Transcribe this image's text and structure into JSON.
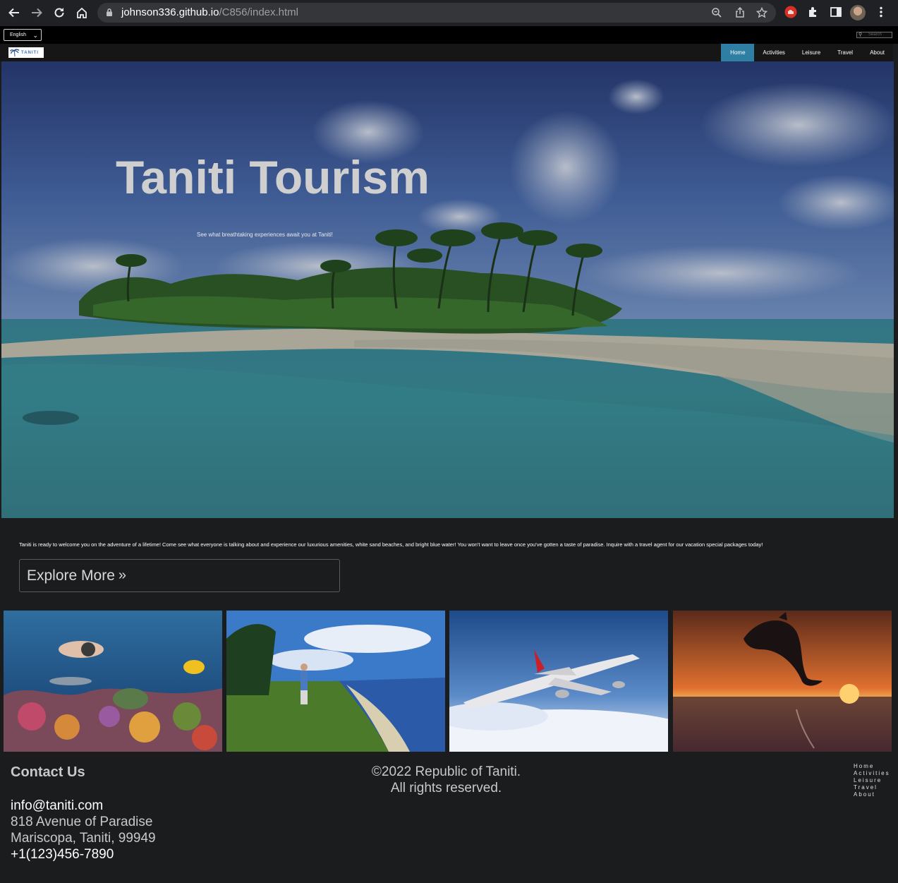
{
  "browser": {
    "url_host": "johnson336.github.io",
    "url_path": "/C856/index.html"
  },
  "utility": {
    "language": "English",
    "search_placeholder": "Search"
  },
  "nav": {
    "logo_text": "TANITI",
    "links": [
      "Home",
      "Activities",
      "Leisure",
      "Travel",
      "About"
    ],
    "active": "Home",
    "active_color": "#2f7fa4"
  },
  "hero": {
    "title": "Taniti Tourism",
    "subtitle": "See what breathtaking experiences await you at Taniti!"
  },
  "intro": {
    "text": "Taniti is ready to welcome you on the adventure of a lifetime! Come see what everyone is talking about and experience our luxurious amenities, white sand beaches, and bright blue water! You won't want to leave once you've gotten a taste of paradise. Inquire with a travel agent for our vacation special packages today!",
    "button_label": "Explore More"
  },
  "gallery": [
    "snorkeling-reef-photo",
    "golf-course-coast-photo",
    "airplane-flight-photo",
    "dolphin-sunset-photo"
  ],
  "footer": {
    "contact_title": "Contact Us",
    "email": "info@taniti.com",
    "address1": "818 Avenue of Paradise",
    "address2": "Mariscopa, Taniti, 99949",
    "phone": "+1(123)456-7890",
    "copyright1": "©2022 Republic of Taniti.",
    "copyright2": "All rights reserved.",
    "links": [
      "Home",
      "Activities",
      "Leisure",
      "Travel",
      "About"
    ]
  }
}
